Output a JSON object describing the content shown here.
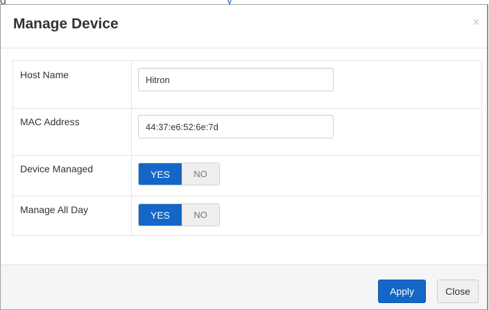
{
  "background": {
    "text_plain": "g",
    "text_link": "y"
  },
  "dialog": {
    "title": "Manage Device",
    "close_glyph": "×"
  },
  "form": {
    "host_name": {
      "label": "Host Name",
      "value": "Hitron"
    },
    "mac_address": {
      "label": "MAC Address",
      "value": "44:37:e6:52:6e:7d"
    },
    "device_managed": {
      "label": "Device Managed",
      "yes_label": "YES",
      "no_label": "NO",
      "selected": "YES"
    },
    "manage_all_day": {
      "label": "Manage All Day",
      "yes_label": "YES",
      "no_label": "NO",
      "selected": "YES"
    }
  },
  "footer": {
    "apply_label": "Apply",
    "close_label": "Close"
  },
  "colors": {
    "primary": "#1466c7",
    "link": "#2b74c8",
    "footer_bg": "#f5f5f5"
  }
}
